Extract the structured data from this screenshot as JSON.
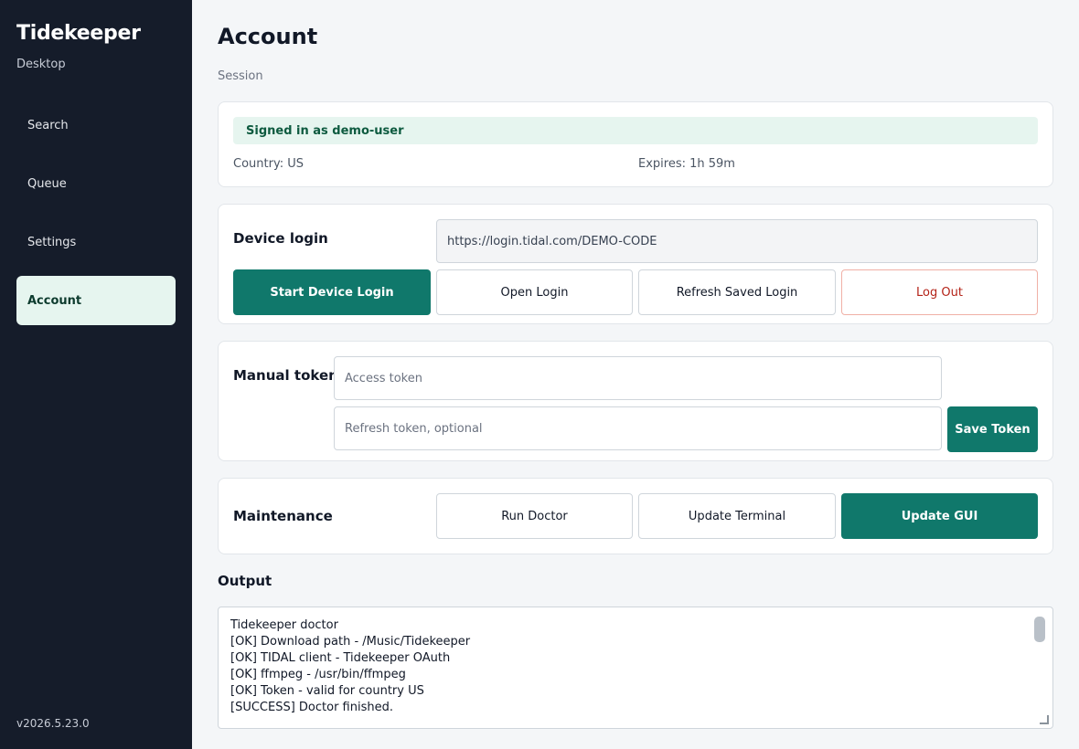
{
  "sidebar": {
    "title": "Tidekeeper",
    "subtitle": "Desktop",
    "items": [
      {
        "label": "Search"
      },
      {
        "label": "Queue"
      },
      {
        "label": "Settings"
      },
      {
        "label": "Account",
        "active": true
      }
    ],
    "version": "v2026.5.23.0"
  },
  "page": {
    "title": "Account",
    "section": "Session"
  },
  "session": {
    "status": "Signed in as demo-user",
    "country": "Country: US",
    "expires": "Expires: 1h 59m"
  },
  "device_login": {
    "label": "Device login",
    "url_value": "https://login.tidal.com/DEMO-CODE",
    "buttons": {
      "start": "Start Device Login",
      "open": "Open Login",
      "refresh": "Refresh Saved Login",
      "logout": "Log Out"
    }
  },
  "manual_token": {
    "label": "Manual token",
    "access_placeholder": "Access token",
    "refresh_placeholder": "Refresh token, optional",
    "save": "Save Token"
  },
  "maintenance": {
    "label": "Maintenance",
    "buttons": {
      "doctor": "Run Doctor",
      "terminal": "Update Terminal",
      "gui": "Update GUI"
    }
  },
  "output": {
    "title": "Output",
    "lines": [
      "Tidekeeper doctor",
      "[OK] Download path - /Music/Tidekeeper",
      "[OK] TIDAL client - Tidekeeper OAuth",
      "[OK] ffmpeg - /usr/bin/ffmpeg",
      "[OK] Token - valid for country US",
      "[SUCCESS] Doctor finished."
    ]
  },
  "colors": {
    "sidebar_bg": "#151c2a",
    "accent": "#10786b",
    "active_nav_bg": "#e6f5ef",
    "danger": "#b42318"
  }
}
